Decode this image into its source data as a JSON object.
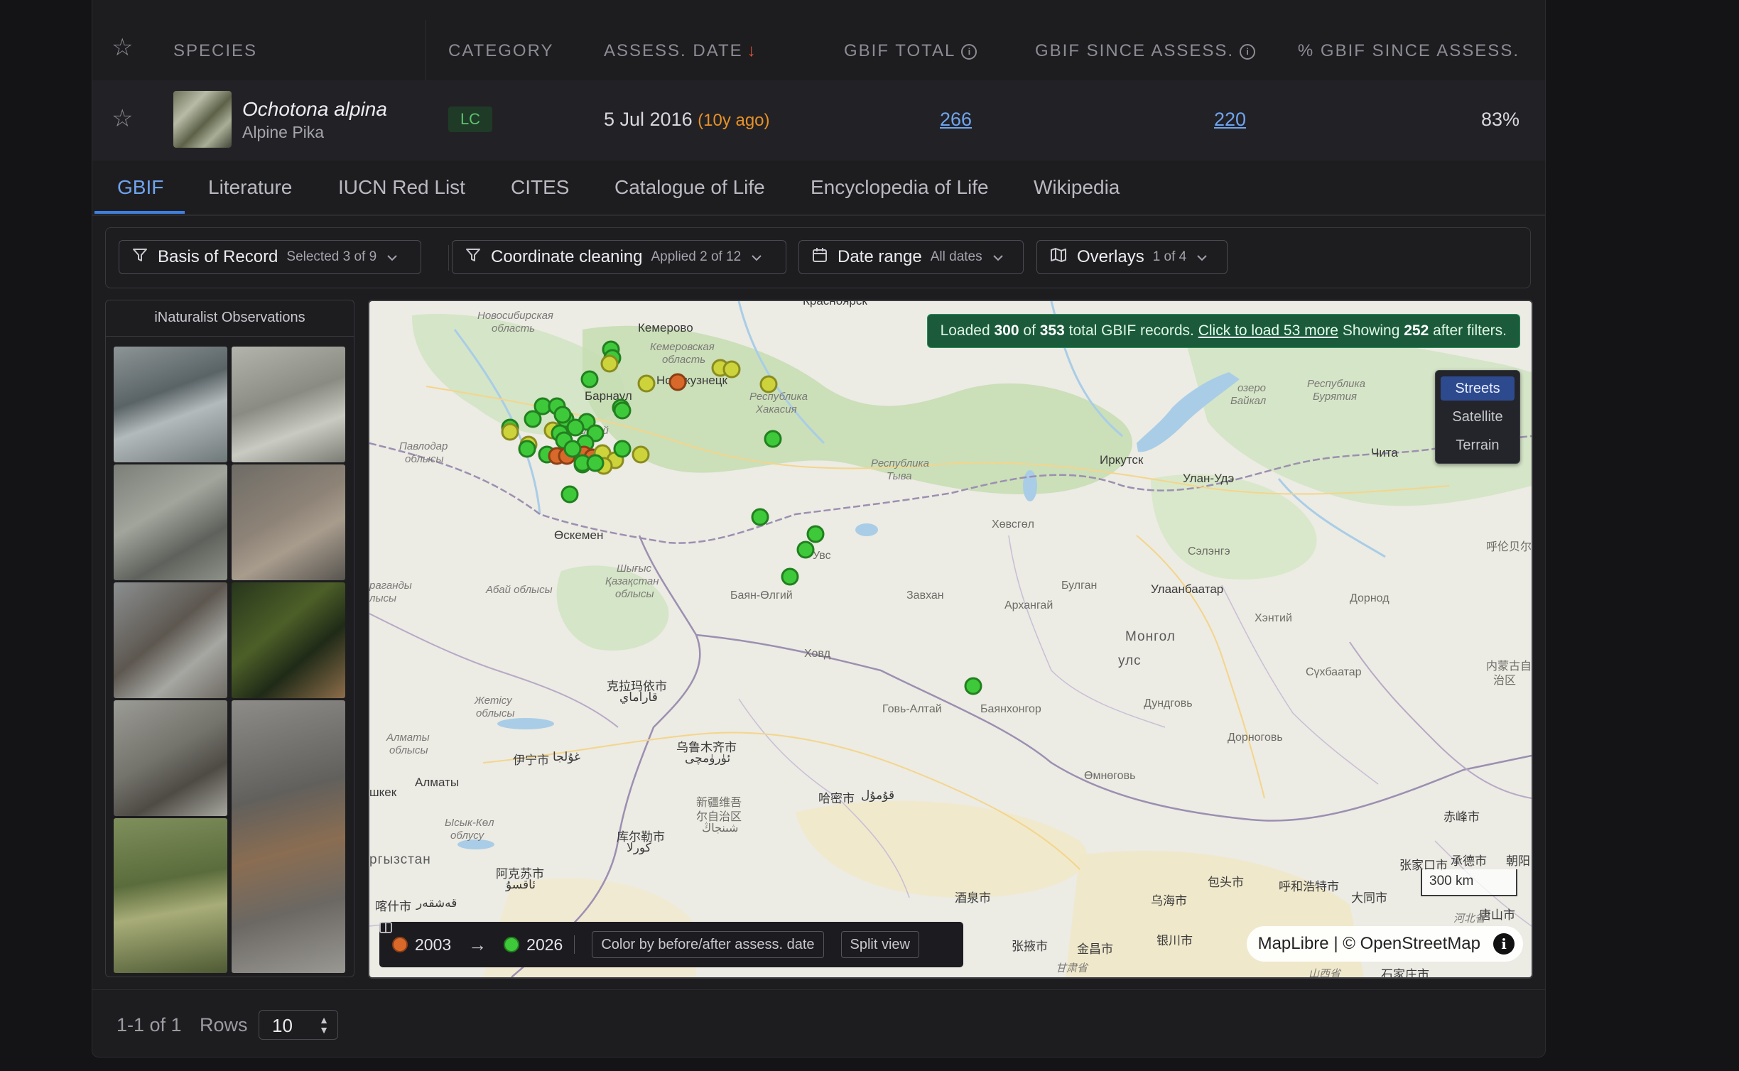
{
  "table": {
    "headers": {
      "species": "SPECIES",
      "category": "CATEGORY",
      "assess_date": "ASSESS. DATE",
      "sort_arrow": "↓",
      "gbif_total": "GBIF TOTAL",
      "gbif_since": "GBIF SINCE ASSESS.",
      "pct_since": "% GBIF SINCE ASSESS."
    },
    "row": {
      "scientific_name": "Ochotona alpina",
      "common_name": "Alpine Pika",
      "category": "LC",
      "assess_date": "5 Jul 2016",
      "assess_ago": "(10y ago)",
      "gbif_total": "266",
      "gbif_since": "220",
      "pct_since": "83%"
    }
  },
  "tabs": [
    "GBIF",
    "Literature",
    "IUCN Red List",
    "CITES",
    "Catalogue of Life",
    "Encyclopedia of Life",
    "Wikipedia"
  ],
  "active_tab": "GBIF",
  "filters": {
    "basis": {
      "label": "Basis of Record",
      "sub": "Selected 3 of 9"
    },
    "coords": {
      "label": "Coordinate cleaning",
      "sub": "Applied 2 of 12"
    },
    "date": {
      "label": "Date range",
      "sub": "All dates"
    },
    "overlays": {
      "label": "Overlays",
      "sub": "1 of 4"
    }
  },
  "inat": {
    "title": "iNaturalist Observations"
  },
  "map": {
    "status": {
      "prefix": "Loaded",
      "loaded": "300",
      "of": "of",
      "total": "353",
      "suffix": "total GBIF records.",
      "load_more": "Click to load 53 more",
      "showing": "Showing",
      "shown": "252",
      "after": "after filters."
    },
    "layers": [
      "Streets",
      "Satellite",
      "Terrain"
    ],
    "active_layer": "Streets",
    "scale": "300 km",
    "attribution": "MapLibre | © OpenStreetMap",
    "legend": {
      "from_year": "2003",
      "arrow": "→",
      "to_year": "2026",
      "color_button": "Color by before/after assess. date",
      "split_button": "Split view"
    },
    "labels": {
      "kemerovo": "Кемерово",
      "krasnoyarsk": "Красноярск",
      "novosibirsk_obl": "Новосибирская",
      "novosibirsk_obl2": "область",
      "kemerovo_obl": "Кемеровская",
      "kemerovo_obl2": "область",
      "novokuznetsk": "Новокузнецк",
      "barnaul": "Барнаул",
      "khakasia": "Республика",
      "khakasia2": "Хакасия",
      "altai_krai": "Алтайский",
      "altai_krai2": "край",
      "pavlodar": "Павлодар",
      "pavlodar2": "облысы",
      "tyva": "Республика",
      "tyva2": "Тыва",
      "oskemen": "Өскемен",
      "east_kz": "Шығыс",
      "east_kz2": "Қазақстан",
      "east_kz3": "облысы",
      "abai": "Абай облысы",
      "karaganda": "раганды",
      "karaganda2": "лысы",
      "ulaangom": "Увс",
      "bayan_olgii": "Баян-Өлгий",
      "khovd": "Ховд",
      "zavkhan": "Завхан",
      "khovsgol": "Хөвсгөл",
      "arkhangai": "Архангай",
      "bulgan": "Булган",
      "selenge": "Сэлэнгэ",
      "irkutsk": "Иркутск",
      "ulan_ude": "Улан-Удэ",
      "chita": "Чита",
      "baikal": "озеро",
      "baikal2": "Байкал",
      "buryatia": "Республика",
      "buryatia2": "Бурятия",
      "ulaanbaatar": "Улаанбаатар",
      "mongolia": "Монгол",
      "mongolia2": "улс",
      "khentii": "Хэнтий",
      "dornod": "Дорнод",
      "sukhbaatar": "Сүхбаатар",
      "dundgovi": "Дундговь",
      "dornogovi": "Дорноговь",
      "omnogovi": "Өмнөговь",
      "bayankhongor": "Баянхонгор",
      "govi_altai": "Говь-Алтай",
      "hulunbuir": "呼伦贝尔",
      "inner_mongolia": "内蒙古自",
      "inner_mongolia2": "治区",
      "karamay": "克拉玛依市",
      "karamay2": "قاراماي",
      "urumqi": "乌鲁木齐市",
      "urumqi2": "ئۈرۈمچى",
      "yining": "伊宁市",
      "yining2": "غۇلجا",
      "hami": "哈密市",
      "hami2": "قۇمۇل",
      "xinjiang": "新疆维吾",
      "xinjiang2": "尔自治区",
      "xinjiang3": "شىنجاڭ",
      "korla": "库尔勒市",
      "korla2": "كورلا",
      "aksu": "阿克苏市",
      "aksu2": "ئاقسۇ",
      "kashgar": "喀什市",
      "kashgar2": "قەشقەر",
      "almaty": "Алматы",
      "almaty_obl": "Алматы",
      "almaty_obl2": "облысы",
      "zhetisu": "Жетісу",
      "zhetisu2": "облысы",
      "issyk": "Ысык-Көл",
      "issyk2": "облусу",
      "kyrgyzstan": "ргызстан",
      "bishkek": "шкек",
      "jiuquan": "酒泉市",
      "zhangye": "张掖市",
      "jinchang": "金昌市",
      "yinchuan": "银川市",
      "wuhai": "乌海市",
      "baotou": "包头市",
      "hohhot": "呼和浩特市",
      "datong": "大同市",
      "zhangjiakou": "张家口市",
      "chengde": "承德市",
      "chifeng": "赤峰市",
      "tangshan": "唐山市",
      "hebei": "河北省",
      "shijiazhuang": "石家庄市",
      "gansu": "甘肃省",
      "shanxi": "山西省",
      "chaoyang": "朝阳"
    }
  },
  "colors": {
    "before": "#d9692a",
    "after": "#3ec93a",
    "mixed": "#cdd33a",
    "accent": "#3f7ee0",
    "category_lc": "#5cc26e"
  },
  "footer": {
    "pagination": "1-1 of 1",
    "rows_label": "Rows",
    "rows_value": "10"
  }
}
